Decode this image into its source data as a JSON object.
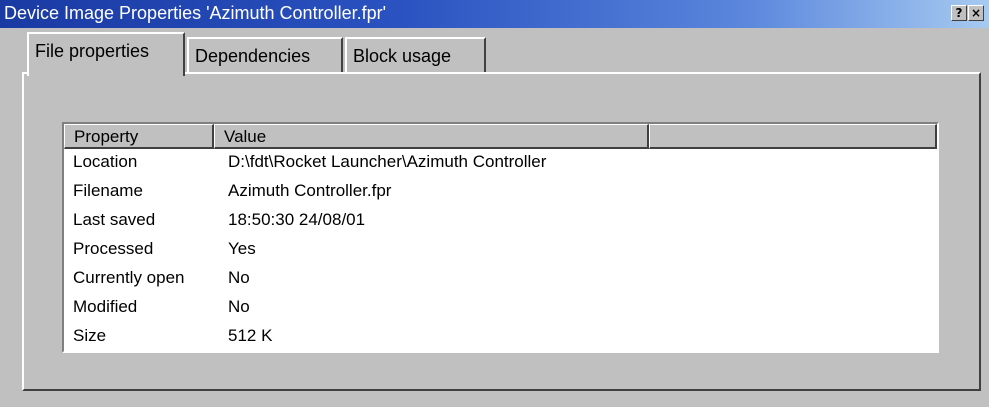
{
  "window": {
    "title": "Device Image Properties 'Azimuth Controller.fpr'",
    "help_glyph": "?",
    "close_glyph": "×"
  },
  "tabs": [
    {
      "label": "File properties",
      "active": true
    },
    {
      "label": "Dependencies",
      "active": false
    },
    {
      "label": "Block usage",
      "active": false
    }
  ],
  "table": {
    "columns": [
      "Property",
      "Value",
      ""
    ],
    "rows": [
      {
        "property": "Location",
        "value": "D:\\fdt\\Rocket Launcher\\Azimuth Controller"
      },
      {
        "property": "Filename",
        "value": "Azimuth Controller.fpr"
      },
      {
        "property": "Last saved",
        "value": "18:50:30   24/08/01"
      },
      {
        "property": "Processed",
        "value": "Yes"
      },
      {
        "property": "Currently open",
        "value": "No"
      },
      {
        "property": "Modified",
        "value": "No"
      },
      {
        "property": "Size",
        "value": "512 K"
      }
    ]
  },
  "colors": {
    "titlebar_start": "#1a3aa3",
    "titlebar_end": "#a6caf0",
    "face": "#c0c0c0"
  }
}
